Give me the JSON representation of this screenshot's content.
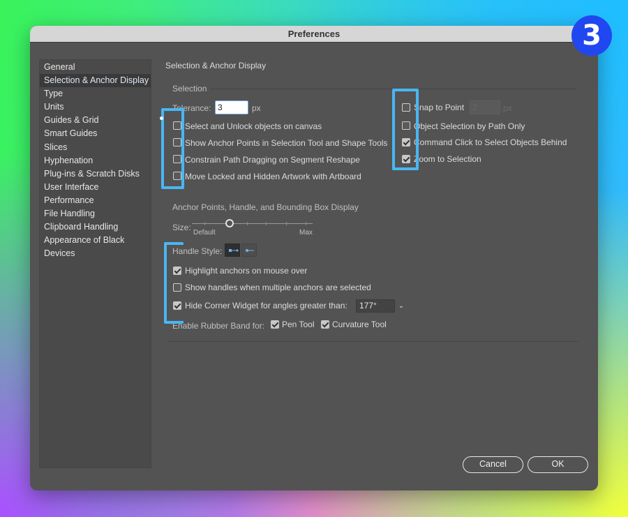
{
  "window": {
    "title": "Preferences"
  },
  "sidebar": {
    "items": [
      {
        "label": "General"
      },
      {
        "label": "Selection & Anchor Display",
        "selected": true
      },
      {
        "label": "Type"
      },
      {
        "label": "Units"
      },
      {
        "label": "Guides & Grid"
      },
      {
        "label": "Smart Guides"
      },
      {
        "label": "Slices"
      },
      {
        "label": "Hyphenation"
      },
      {
        "label": "Plug-ins & Scratch Disks"
      },
      {
        "label": "User Interface"
      },
      {
        "label": "Performance"
      },
      {
        "label": "File Handling"
      },
      {
        "label": "Clipboard Handling"
      },
      {
        "label": "Appearance of Black"
      },
      {
        "label": "Devices"
      }
    ]
  },
  "panel": {
    "title": "Selection & Anchor Display",
    "selection": {
      "heading": "Selection",
      "tolerance_label": "Tolerance:",
      "tolerance_value": "3",
      "tolerance_unit": "px",
      "snap_value": "2",
      "snap_unit": "px",
      "left_options": [
        {
          "label": "Select and Unlock objects on canvas",
          "checked": false
        },
        {
          "label": "Show Anchor Points in Selection Tool and Shape Tools",
          "checked": false
        },
        {
          "label": "Constrain Path Dragging on Segment Reshape",
          "checked": false
        },
        {
          "label": "Move Locked and Hidden Artwork with Artboard",
          "checked": false
        }
      ],
      "right_options": [
        {
          "label": "Snap to Point",
          "checked": false
        },
        {
          "label": "Object Selection by Path Only",
          "checked": false
        },
        {
          "label": "Command Click to Select Objects Behind",
          "checked": true
        },
        {
          "label": "Zoom to Selection",
          "checked": true
        }
      ]
    },
    "anchor": {
      "heading": "Anchor Points, Handle, and Bounding Box Display",
      "size_label": "Size:",
      "size_min_label": "Default",
      "size_max_label": "Max",
      "size_level": 0.25,
      "handle_style_label": "Handle Style:",
      "options": [
        {
          "label": "Highlight anchors on mouse over",
          "checked": true
        },
        {
          "label": "Show handles when multiple anchors are selected",
          "checked": false
        },
        {
          "label": "Hide Corner Widget for angles greater than:",
          "checked": true
        }
      ],
      "corner_angle": "177°",
      "rubber_band_label": "Enable Rubber Band for:",
      "rubber_band_pen": {
        "label": "Pen Tool",
        "checked": true
      },
      "rubber_band_curvature": {
        "label": "Curvature Tool",
        "checked": true
      }
    }
  },
  "buttons": {
    "cancel": "Cancel",
    "ok": "OK"
  },
  "badge": {
    "number": "3"
  },
  "colors": {
    "annotation": "#49b6f3",
    "badge": "#2147f0",
    "dialog_bg": "#535353"
  }
}
